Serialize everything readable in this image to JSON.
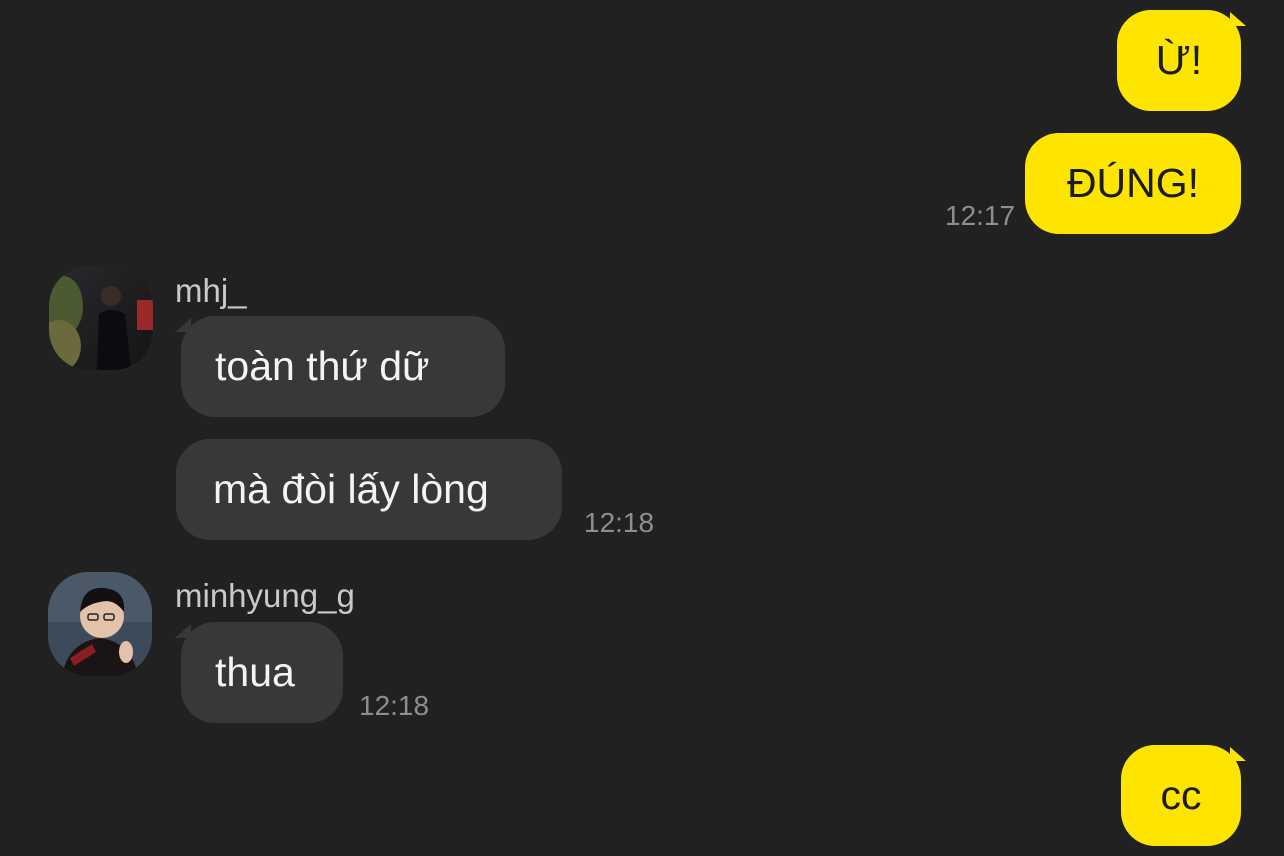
{
  "colors": {
    "background": "#212121",
    "my_bubble": "#fee500",
    "their_bubble": "#383838",
    "timestamp": "#8e8e8e"
  },
  "messages": [
    {
      "from": "me",
      "text": "Ừ!"
    },
    {
      "from": "me",
      "text": "ĐÚNG!",
      "time": "12:17"
    },
    {
      "from": "mhj_",
      "text": "toàn thứ dữ"
    },
    {
      "from": "mhj_",
      "text": "mà đòi lấy lòng",
      "time": "12:18"
    },
    {
      "from": "minhyung_g",
      "text": "thua",
      "time": "12:18"
    },
    {
      "from": "me",
      "text": "cc"
    }
  ],
  "senders": {
    "mhj": {
      "name": "mhj_",
      "avatar_icon": "user-photo-icon"
    },
    "minhyung": {
      "name": "minhyung_g",
      "avatar_icon": "user-photo-icon"
    }
  }
}
